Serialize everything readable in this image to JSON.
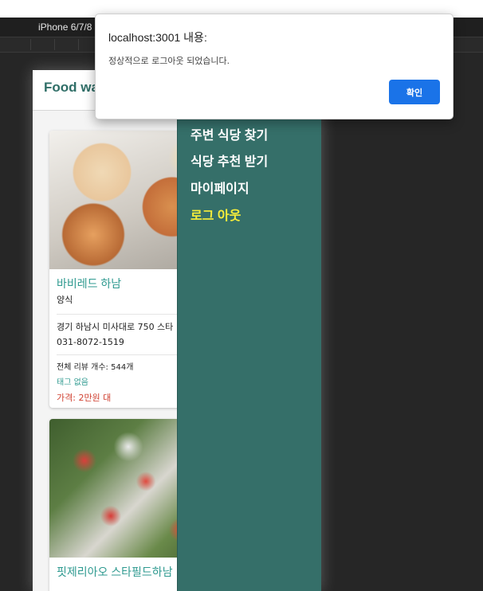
{
  "devtools": {
    "device": "iPhone 6/7/8"
  },
  "app": {
    "title": "Food wa"
  },
  "menu": {
    "items": [
      {
        "label": "주변 식당 찾기"
      },
      {
        "label": "식당 추천 받기"
      },
      {
        "label": "마이페이지"
      },
      {
        "label": "로그 아웃"
      }
    ],
    "accent_color": "#f7ee3a",
    "background_color": "#356f69"
  },
  "restaurants": [
    {
      "name": "바비레드 하남",
      "category": "양식",
      "address": "경기 하남시 미사대로 750 스타",
      "phone": "031-8072-1519",
      "reviews": "전체 리뷰 개수: 544개",
      "tags": "태그 없음",
      "price": "가격: 2만원 대"
    },
    {
      "name": "핏제리아오 스타필드하남"
    }
  ],
  "dialog": {
    "title": "localhost:3001 내용:",
    "message": "정상적으로 로그아웃 되었습니다.",
    "confirm_label": "확인",
    "button_color": "#1a73e8"
  }
}
